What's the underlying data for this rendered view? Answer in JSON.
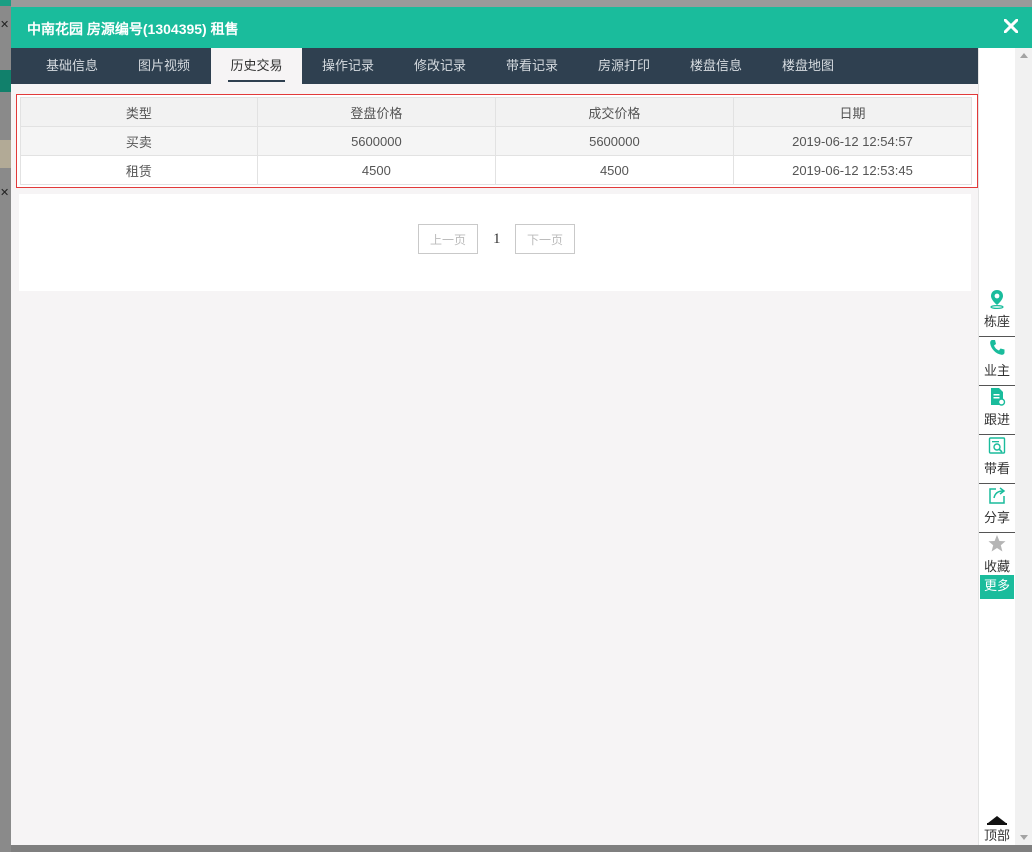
{
  "window": {
    "title": "中南花园 房源编号(1304395) 租售"
  },
  "tabs": [
    {
      "label": "基础信息"
    },
    {
      "label": "图片视频"
    },
    {
      "label": "历史交易"
    },
    {
      "label": "操作记录"
    },
    {
      "label": "修改记录"
    },
    {
      "label": "带看记录"
    },
    {
      "label": "房源打印"
    },
    {
      "label": "楼盘信息"
    },
    {
      "label": "楼盘地图"
    }
  ],
  "active_tab": "历史交易",
  "history": {
    "columns": [
      "类型",
      "登盘价格",
      "成交价格",
      "日期"
    ],
    "rows": [
      {
        "type": "买卖",
        "list_price": "5600000",
        "deal_price": "5600000",
        "date": "2019-06-12 12:54:57"
      },
      {
        "type": "租赁",
        "list_price": "4500",
        "deal_price": "4500",
        "date": "2019-06-12 12:53:45"
      }
    ]
  },
  "pagination": {
    "prev_label": "上一页",
    "current_page": "1",
    "next_label": "下一页"
  },
  "side_rail": {
    "items": [
      {
        "label": "栋座",
        "icon": "location-pin-icon"
      },
      {
        "label": "业主",
        "icon": "phone-icon"
      },
      {
        "label": "跟进",
        "icon": "document-icon"
      },
      {
        "label": "带看",
        "icon": "search-document-icon"
      },
      {
        "label": "分享",
        "icon": "share-icon"
      },
      {
        "label": "收藏",
        "icon": "star-icon"
      }
    ],
    "more_label": "更多",
    "top_label": "顶部"
  },
  "colors": {
    "accent": "#1abc9c",
    "tab_bar": "#2f4050",
    "highlight_border": "#e23a3a"
  }
}
